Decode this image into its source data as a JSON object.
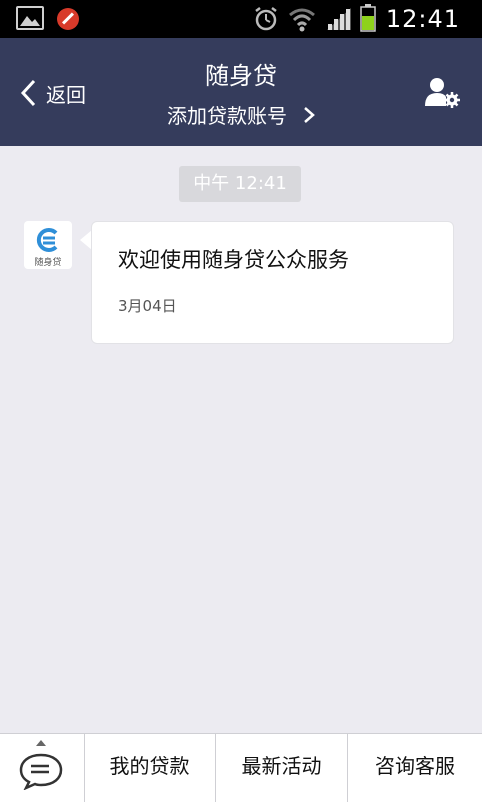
{
  "status_bar": {
    "time": "12:41"
  },
  "header": {
    "back_label": "返回",
    "title": "随身贷",
    "subtitle": "添加贷款账号"
  },
  "chat": {
    "time_chip": "中午 12:41",
    "avatar_label": "随身贷",
    "message_text": "欢迎使用随身贷公众服务",
    "message_date": "3月04日"
  },
  "bottom_menu": {
    "items": [
      {
        "label": "我的贷款"
      },
      {
        "label": "最新活动"
      },
      {
        "label": "咨询客服"
      }
    ]
  },
  "colors": {
    "header_bg": "#353c5c",
    "chat_bg": "#ecebf1",
    "accent_blue": "#2f8fd8",
    "battery_green": "#8ed21c"
  },
  "icons": {
    "status": [
      "gallery-icon",
      "blocked-icon",
      "alarm-icon",
      "wifi-icon",
      "signal-icon",
      "battery-icon"
    ],
    "header": [
      "chevron-left-icon",
      "chevron-right-icon",
      "user-settings-icon"
    ],
    "bottom": [
      "keyboard-chat-icon"
    ]
  }
}
